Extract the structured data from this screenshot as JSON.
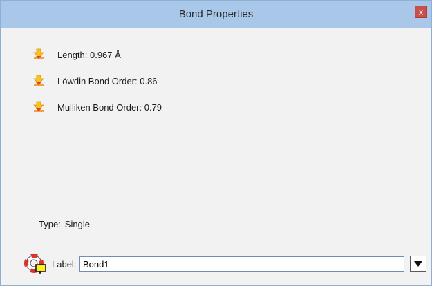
{
  "window": {
    "title": "Bond Properties",
    "close_label": "x"
  },
  "properties": [
    {
      "label": "Length: 0.967 Å",
      "icon": "arrow-down-icon"
    },
    {
      "label": "Löwdin Bond Order: 0.86",
      "icon": "arrow-down-icon"
    },
    {
      "label": "Mulliken Bond Order: 0.79",
      "icon": "arrow-down-icon"
    }
  ],
  "type": {
    "label": "Type:",
    "value": "Single"
  },
  "label_field": {
    "caption": "Label:",
    "value": "Bond1",
    "icon": "lifebuoy-label-icon",
    "dropdown_icon": "triangle-down-icon"
  },
  "colors": {
    "titlebar": "#a9c7e8",
    "close": "#c7504c",
    "background": "#f2f2f2"
  }
}
